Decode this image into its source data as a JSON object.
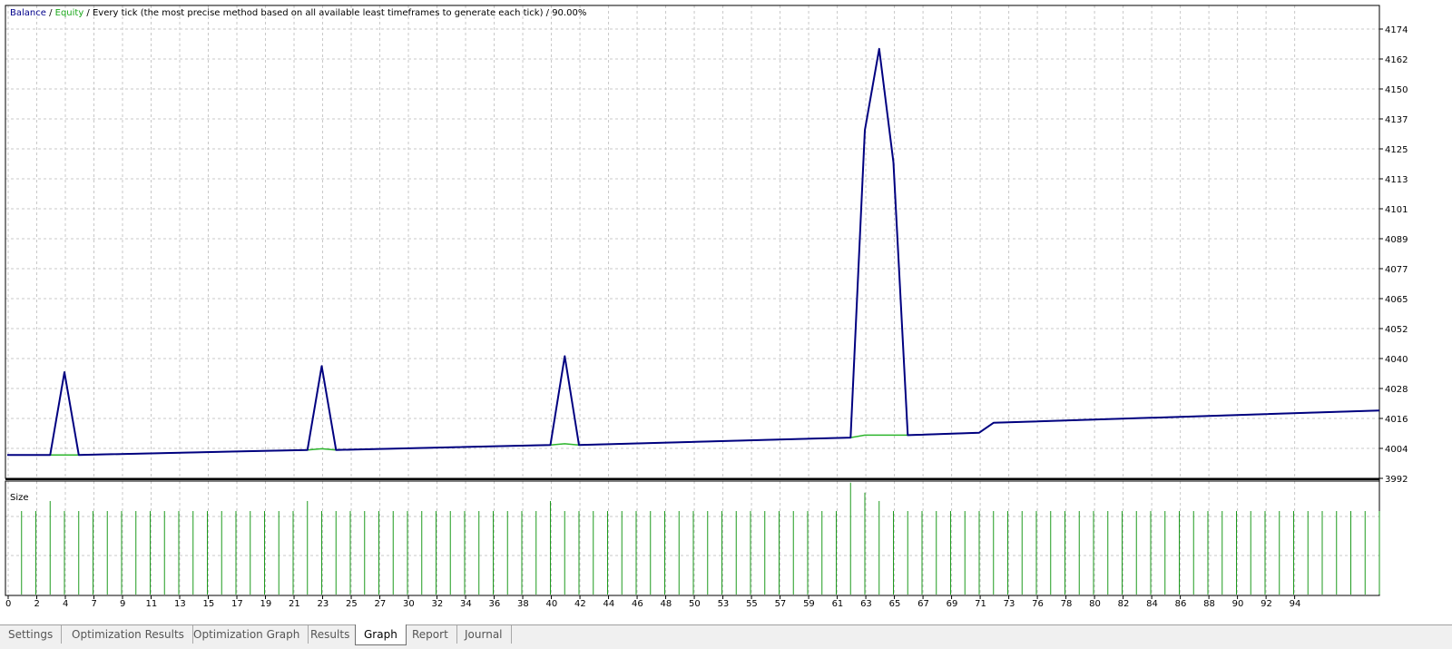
{
  "header": {
    "balance_label": "Balance",
    "slash1": " / ",
    "equity_label": "Equity",
    "description": " / Every tick (the most precise method based on all available least timeframes to generate each tick) / 90.00%"
  },
  "size_panel_label": "Size",
  "tabs": [
    {
      "label": "Settings",
      "active": false
    },
    {
      "label": "Optimization Results",
      "active": false
    },
    {
      "label": "Optimization Graph",
      "active": false
    },
    {
      "label": "Results",
      "active": false
    },
    {
      "label": "Graph",
      "active": true
    },
    {
      "label": "Report",
      "active": false
    },
    {
      "label": "Journal",
      "active": false
    }
  ],
  "colors": {
    "balance": "#000080",
    "equity": "#2db52d",
    "size_bars": "#1e9a1e",
    "grid": "#c8c8c8"
  },
  "chart_data": {
    "type": "line",
    "y_ticks": [
      "4174",
      "4162",
      "4150",
      "4137",
      "4125",
      "4113",
      "4101",
      "4089",
      "4077",
      "4065",
      "4052",
      "4040",
      "4028",
      "4016",
      "4004",
      "3992"
    ],
    "x_ticks": [
      "0",
      "2",
      "4",
      "7",
      "9",
      "11",
      "13",
      "15",
      "17",
      "19",
      "21",
      "23",
      "25",
      "27",
      "30",
      "32",
      "34",
      "36",
      "38",
      "40",
      "42",
      "44",
      "46",
      "48",
      "50",
      "53",
      "55",
      "57",
      "59",
      "61",
      "63",
      "65",
      "67",
      "69",
      "71",
      "73",
      "76",
      "78",
      "80",
      "82",
      "84",
      "86",
      "88",
      "90",
      "92",
      "94"
    ],
    "ylim": [
      3992,
      4174
    ],
    "xlim": [
      0,
      96
    ],
    "grid": true,
    "series": [
      {
        "name": "Balance",
        "x": [
          0,
          3,
          4,
          5,
          21,
          22,
          23,
          38,
          39,
          40,
          59,
          60,
          61,
          62,
          63,
          68,
          69,
          96
        ],
        "y": [
          4001.5,
          4001.5,
          4035,
          4001.5,
          4003.5,
          4037.5,
          4003.5,
          4005.5,
          4041.5,
          4005.5,
          4008.5,
          4133,
          4166,
          4120,
          4009.5,
          4010.5,
          4014.5,
          4019.5
        ]
      },
      {
        "name": "Equity",
        "x": [
          0,
          3,
          4,
          5,
          21,
          22,
          23,
          38,
          39,
          40,
          59,
          60,
          61,
          62,
          63,
          68,
          69,
          96
        ],
        "y": [
          4001.5,
          4001.5,
          4001.5,
          4001.5,
          4003.5,
          4004,
          4003.5,
          4005.5,
          4006,
          4005.5,
          4008.5,
          4009.5,
          4009.5,
          4009.5,
          4009.5,
          4010.5,
          4014.5,
          4019.5
        ]
      }
    ],
    "size": {
      "base": 1,
      "bars": [
        1,
        1,
        1,
        1.12,
        1,
        1,
        1,
        1,
        1,
        1,
        1,
        1,
        1,
        1,
        1,
        1,
        1,
        1,
        1,
        1,
        1,
        1.12,
        1,
        1,
        1,
        1,
        1,
        1,
        1,
        1,
        1,
        1,
        1,
        1,
        1,
        1,
        1,
        1,
        1.12,
        1,
        1,
        1,
        1,
        1,
        1,
        1,
        1,
        1,
        1,
        1,
        1,
        1,
        1,
        1,
        1,
        1,
        1,
        1,
        1,
        1.34,
        1.22,
        1.12,
        1,
        1,
        1,
        1,
        1,
        1,
        1,
        1,
        1,
        1,
        1,
        1,
        1,
        1,
        1,
        1,
        1,
        1,
        1,
        1,
        1,
        1,
        1,
        1,
        1,
        1,
        1,
        1,
        1,
        1,
        1,
        1,
        1,
        1,
        1
      ]
    }
  }
}
